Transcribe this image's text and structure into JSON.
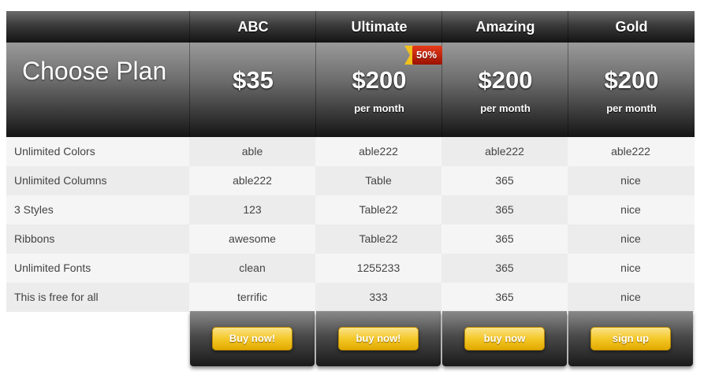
{
  "header": {
    "title": "Choose Plan",
    "plans": [
      {
        "name": "ABC",
        "price": "$35",
        "period": ""
      },
      {
        "name": "Ultimate",
        "price": "$200",
        "period": "per month",
        "badge": "50%"
      },
      {
        "name": "Amazing",
        "price": "$200",
        "period": "per month"
      },
      {
        "name": "Gold",
        "price": "$200",
        "period": "per month"
      }
    ]
  },
  "rows": [
    {
      "feature": "Unlimited Colors",
      "values": [
        "able",
        "able222",
        "able222",
        "able222"
      ]
    },
    {
      "feature": "Unlimited Columns",
      "values": [
        "able222",
        "Table",
        "365",
        "nice"
      ]
    },
    {
      "feature": "3 Styles",
      "values": [
        "123",
        "Table22",
        "365",
        "nice"
      ]
    },
    {
      "feature": "Ribbons",
      "values": [
        "awesome",
        "Table22",
        "365",
        "nice"
      ]
    },
    {
      "feature": "Unlimited Fonts",
      "values": [
        "clean",
        "1255233",
        "365",
        "nice"
      ]
    },
    {
      "feature": "This is free for all",
      "values": [
        "terrific",
        "333",
        "365",
        "nice"
      ]
    }
  ],
  "buttons": [
    "Buy now!",
    "buy now!",
    "buy now",
    "sign up"
  ],
  "colors": {
    "header_dark": "#141414",
    "header_light": "#9a9a9a",
    "button_yellow": "#f4c828",
    "badge_red": "#c81e0a",
    "badge_yellow": "#f2c11c",
    "row_light": "#f5f5f5",
    "row_dark": "#ececec"
  }
}
